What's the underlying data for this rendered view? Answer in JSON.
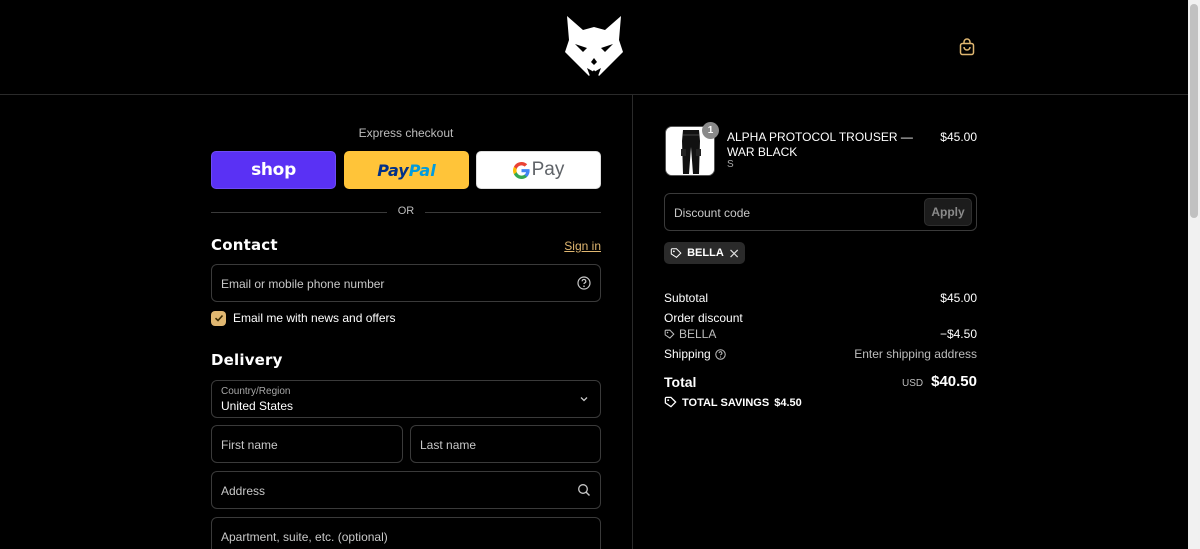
{
  "header": {
    "logo_icon": "wolf-head-logo",
    "cart_icon": "shopping-bag-icon"
  },
  "express": {
    "label": "Express checkout",
    "shop_label": "shop",
    "paypal_label_1": "Pay",
    "paypal_label_2": "Pal",
    "gpay_label": "Pay",
    "or_label": "OR"
  },
  "contact": {
    "title": "Contact",
    "signin_label": "Sign in",
    "email_placeholder": "Email or mobile phone number",
    "news_checkbox_label": "Email me with news and offers",
    "news_checked": true
  },
  "delivery": {
    "title": "Delivery",
    "country_label": "Country/Region",
    "country_value": "United States",
    "first_name_placeholder": "First name",
    "last_name_placeholder": "Last name",
    "address_placeholder": "Address",
    "apartment_placeholder": "Apartment, suite, etc. (optional)"
  },
  "order": {
    "item": {
      "name": "ALPHA PROTOCOL TROUSER — WAR BLACK",
      "variant": "S",
      "price": "$45.00",
      "quantity": "1"
    },
    "discount_placeholder": "Discount code",
    "apply_label": "Apply",
    "applied_code": "BELLA",
    "subtotal_label": "Subtotal",
    "subtotal_value": "$45.00",
    "order_discount_label": "Order discount",
    "discount_code": "BELLA",
    "discount_value": "−$4.50",
    "shipping_label": "Shipping",
    "shipping_value": "Enter shipping address",
    "total_label": "Total",
    "total_currency": "USD",
    "total_value": "$40.50",
    "savings_label": "TOTAL SAVINGS",
    "savings_value": "$4.50"
  },
  "colors": {
    "accent": "#e0b771",
    "shop": "#5a31f4",
    "paypal": "#ffc439",
    "background": "#000000"
  }
}
